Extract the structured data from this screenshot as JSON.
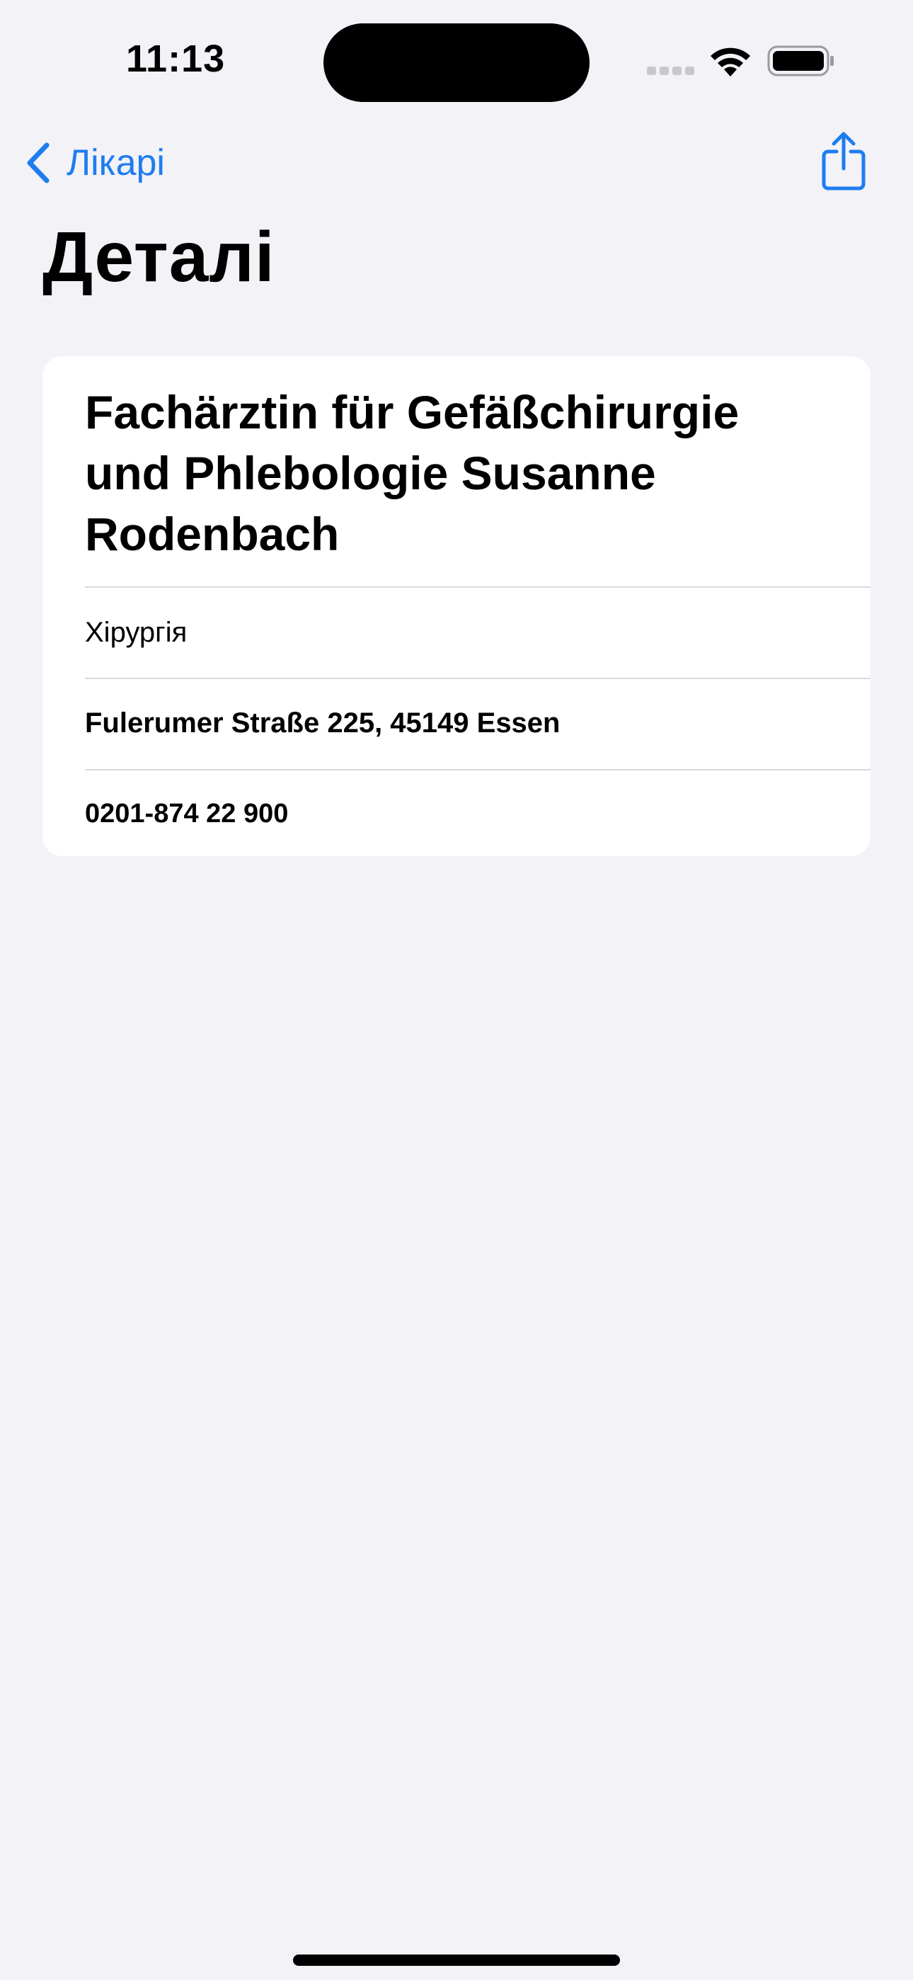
{
  "status_bar": {
    "time": "11:13"
  },
  "nav": {
    "back_label": "Лікарі",
    "accent_color": "#1E7CF0"
  },
  "page": {
    "title": "Деталі"
  },
  "doctor": {
    "name": "Fachärztin für Gefäßchirurgie und Phlebologie Susanne Rodenbach",
    "specialty": "Хірургія",
    "address": "Fulerumer Straße 225, 45149 Essen",
    "phone": "0201-874 22 900"
  },
  "icons": {
    "back": "chevron-left-icon",
    "share": "share-icon",
    "signal": "cellular-signal-icon",
    "wifi": "wifi-icon",
    "battery": "battery-icon"
  }
}
